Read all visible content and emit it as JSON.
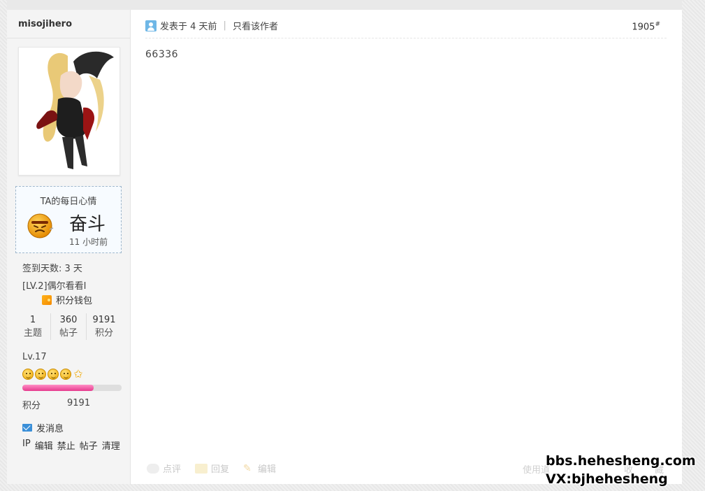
{
  "author": {
    "name": "misojihero",
    "mood": {
      "title": "TA的每日心情",
      "text": "奋斗",
      "time": "11 小时前",
      "icon": "struggle-emoticon"
    },
    "sign_days": "签到天数: 3 天",
    "level_title": "[LV.2]偶尔看看I",
    "wallet_label": "积分钱包",
    "stats": [
      {
        "value": "1",
        "label": "主题"
      },
      {
        "value": "360",
        "label": "帖子"
      },
      {
        "value": "9191",
        "label": "积分"
      }
    ],
    "lv": "Lv.17",
    "level_progress": 0.72,
    "points_label": "积分",
    "points_value": "9191",
    "message_label": "发消息",
    "admin_links": [
      "IP",
      "编辑",
      "禁止",
      "帖子",
      "清理"
    ]
  },
  "post": {
    "posted_label": "发表于 4 天前",
    "separator": "|",
    "only_author_label": "只看该作者",
    "floor": "1905",
    "floor_suffix": "#",
    "content": "66336",
    "actions": [
      {
        "label": "点评",
        "icon": "comment-icon"
      },
      {
        "label": "回复",
        "icon": "reply-icon"
      },
      {
        "label": "编辑",
        "icon": "edit-icon"
      }
    ],
    "use_label": "使用道",
    "tail_a": "收",
    "tail_b": "藏"
  },
  "watermark": {
    "line1": "bbs.hehesheng.com",
    "line2": "VX:bjhehesheng"
  },
  "colors": {
    "accent": "#3a8fd8",
    "progress": "#e63a8d",
    "mood_border": "#9fb7cc"
  }
}
